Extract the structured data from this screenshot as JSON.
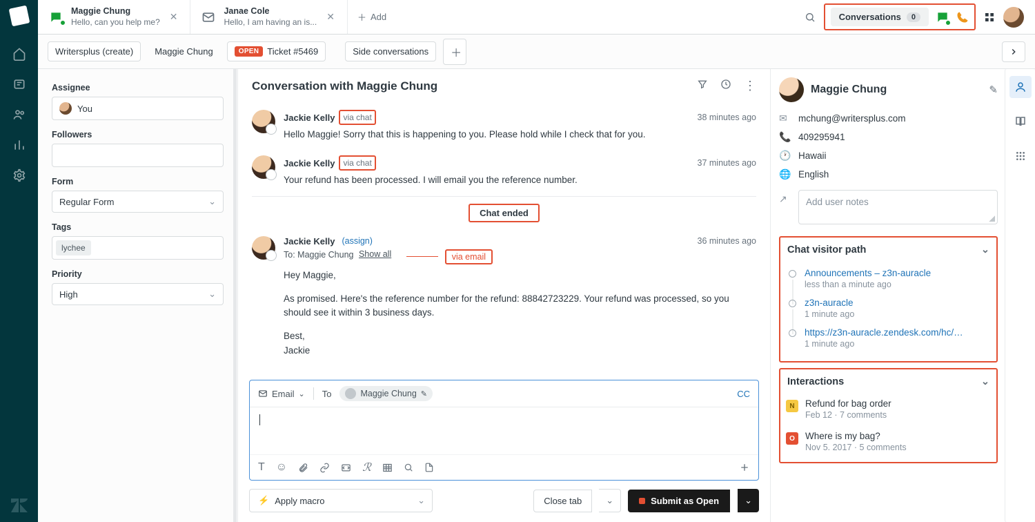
{
  "tabs": [
    {
      "title": "Maggie Chung",
      "sub": "Hello, can you help me?"
    },
    {
      "title": "Janae Cole",
      "sub": "Hello, I am having an is..."
    }
  ],
  "tab_add": "Add",
  "topright": {
    "conversations_label": "Conversations",
    "conversations_count": "0"
  },
  "breadcrumb": {
    "org": "Writersplus (create)",
    "requester": "Maggie Chung",
    "open_badge": "OPEN",
    "ticket": "Ticket #5469",
    "side_conv": "Side conversations"
  },
  "form_panel": {
    "assignee_label": "Assignee",
    "assignee_value": "You",
    "followers_label": "Followers",
    "form_label": "Form",
    "form_value": "Regular Form",
    "tags_label": "Tags",
    "tag1": "lychee",
    "priority_label": "Priority",
    "priority_value": "High"
  },
  "conversation": {
    "title": "Conversation with Maggie Chung",
    "messages": [
      {
        "name": "Jackie Kelly",
        "via": "via chat",
        "time": "38 minutes ago",
        "body": "Hello Maggie! Sorry that this is happening to you. Please hold while I check that for you."
      },
      {
        "name": "Jackie Kelly",
        "via": "via chat",
        "time": "37 minutes ago",
        "body": "Your refund has been processed. I will email you the reference number."
      }
    ],
    "chat_ended": "Chat ended",
    "email_msg": {
      "name": "Jackie Kelly",
      "assign": "(assign)",
      "time": "36 minutes ago",
      "to_prefix": "To:",
      "to_name": "Maggie Chung",
      "show_all": "Show all",
      "via_email": "via email",
      "greeting": "Hey Maggie,",
      "body": "As promised. Here's the reference number for the refund: 88842723229. Your refund was processed, so you should see it within 3 business days.",
      "sign1": "Best,",
      "sign2": "Jackie"
    }
  },
  "composer": {
    "channel": "Email",
    "to_label": "To",
    "recipient": "Maggie Chung",
    "cc": "CC"
  },
  "bottom": {
    "apply_macro": "Apply macro",
    "close_tab": "Close tab",
    "submit": "Submit as Open"
  },
  "rsb": {
    "name": "Maggie Chung",
    "email": "mchung@writersplus.com",
    "phone": "409295941",
    "location": "Hawaii",
    "language": "English",
    "notes_placeholder": "Add user notes",
    "visitor_title": "Chat visitor path",
    "vp": [
      {
        "link": "Announcements – z3n-auracle",
        "time": "less than a minute ago"
      },
      {
        "link": "z3n-auracle",
        "time": "1 minute ago"
      },
      {
        "link": "https://z3n-auracle.zendesk.com/hc/en...",
        "time": "1 minute ago"
      }
    ],
    "interactions_title": "Interactions",
    "ix": [
      {
        "badge": "N",
        "title": "Refund for bag order",
        "meta": "Feb 12 · 7 comments"
      },
      {
        "badge": "O",
        "title": "Where is my bag?",
        "meta": "Nov 5. 2017 · 5 comments"
      }
    ]
  }
}
